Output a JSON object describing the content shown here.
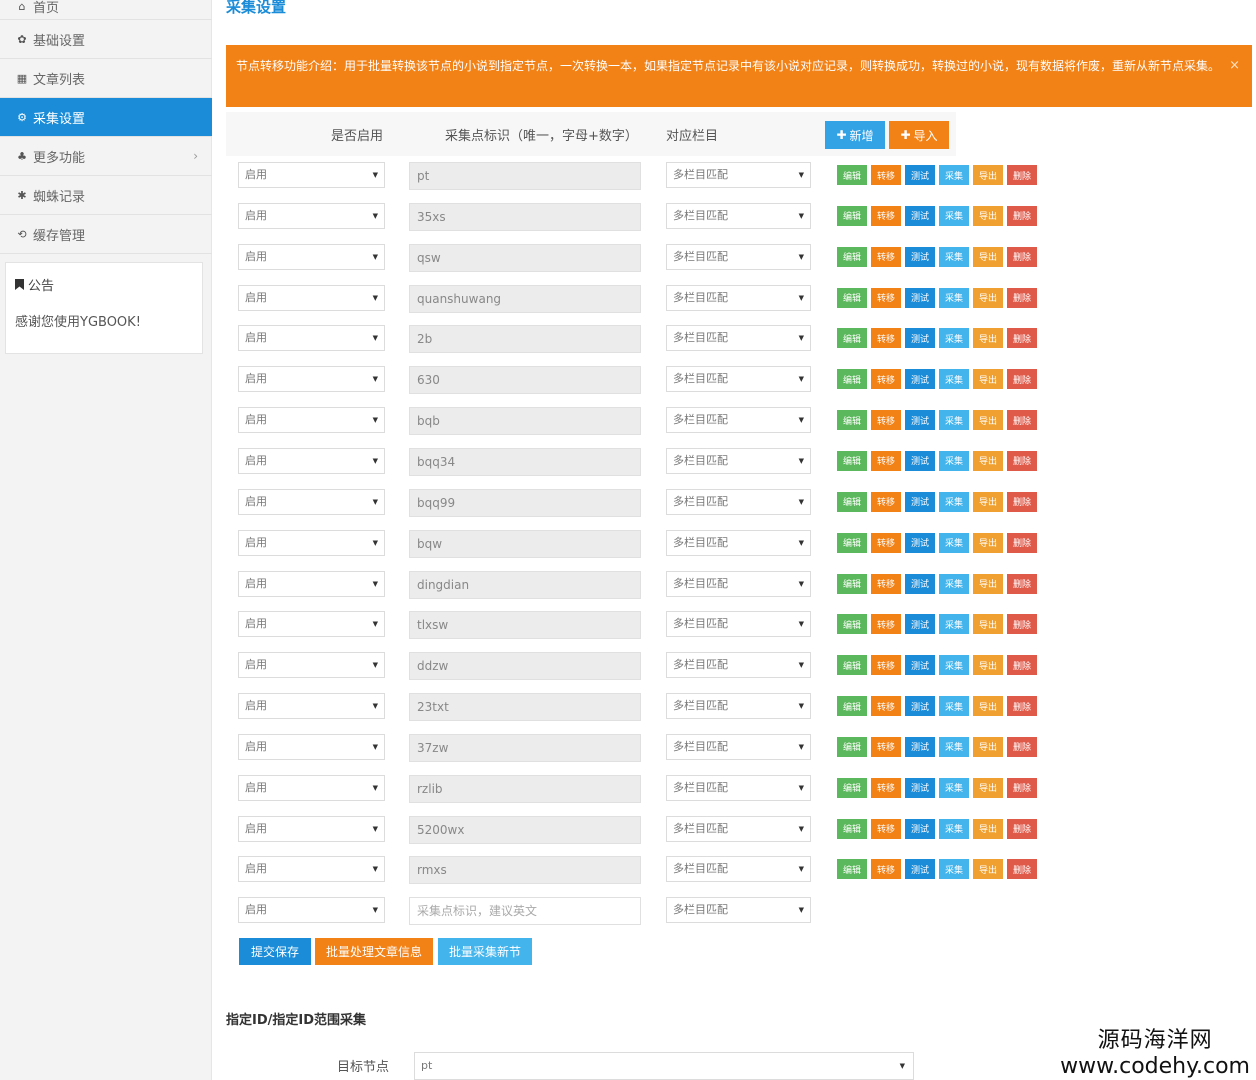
{
  "sidebar": {
    "items": [
      {
        "label": "首页",
        "icon": "home-icon",
        "glyph": "⌂"
      },
      {
        "label": "基础设置",
        "icon": "gear-icon",
        "glyph": "✿"
      },
      {
        "label": "文章列表",
        "icon": "list-icon",
        "glyph": "▦"
      },
      {
        "label": "采集设置",
        "icon": "gears-icon",
        "glyph": "⚙"
      },
      {
        "label": "更多功能",
        "icon": "sitemap-icon",
        "glyph": "♣"
      },
      {
        "label": "蜘蛛记录",
        "icon": "bug-icon",
        "glyph": "✱"
      },
      {
        "label": "缓存管理",
        "icon": "refresh-icon",
        "glyph": "⟲"
      }
    ],
    "chevron": "›",
    "notice": {
      "title": "公告",
      "text": "感谢您使用YGBOOK!"
    }
  },
  "main": {
    "title": "采集设置",
    "alert": "节点转移功能介绍：用于批量转换该节点的小说到指定节点，一次转换一本，如果指定节点记录中有该小说对应记录，则转换成功，转换过的小说，现有数据将作废，重新从新节点采集。",
    "alert_close": "×",
    "headers": {
      "enabled": "是否启用",
      "identifier": "采集点标识（唯一，字母+数字）",
      "column": "对应栏目"
    },
    "header_buttons": {
      "add": "新增",
      "import": "导入",
      "add_glyph": "✚",
      "import_glyph": "✚"
    },
    "enable_value": "启用",
    "column_value": "多栏目匹配",
    "action_labels": {
      "edit": "编辑",
      "move": "转移",
      "test": "测试",
      "collect": "采集",
      "export": "导出",
      "delete": "删除"
    },
    "nodes": [
      "pt",
      "35xs",
      "qsw",
      "quanshuwang",
      "2b",
      "630",
      "bqb",
      "bqq34",
      "bqq99",
      "bqw",
      "dingdian",
      "tlxsw",
      "ddzw",
      "23txt",
      "37zw",
      "rzlib",
      "5200wx",
      "rmxs"
    ],
    "new_placeholder": "采集点标识，建议英文",
    "bottom_buttons": {
      "save": "提交保存",
      "batch": "批量处理文章信息",
      "new_chapters": "批量采集新节"
    },
    "section_title": "指定ID/指定ID范围采集",
    "target_label": "目标节点",
    "target_value": "pt"
  },
  "watermark": {
    "line1": "源码海洋网",
    "line2": "www.codehy.com"
  }
}
